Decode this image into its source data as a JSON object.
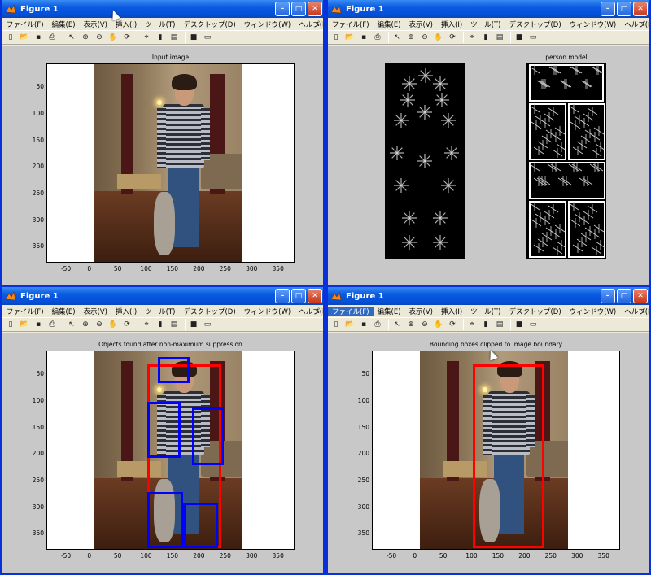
{
  "windows": [
    {
      "title": "Figure 1",
      "axes_title": "Input image",
      "active_menu": -1
    },
    {
      "title": "Figure 1",
      "axes_title": "",
      "model_title": "person model",
      "active_menu": -1
    },
    {
      "title": "Figure 1",
      "axes_title": "Objects found after non-maximum suppression",
      "active_menu": -1
    },
    {
      "title": "Figure 1",
      "axes_title": "Bounding boxes clipped to image boundary",
      "active_menu": 0
    }
  ],
  "menu": [
    "ファイル(F)",
    "編集(E)",
    "表示(V)",
    "挿入(I)",
    "ツール(T)",
    "デスクトップ(D)",
    "ウィンドウ(W)",
    "ヘルプ(H)"
  ],
  "toolbar_icons": [
    "new-file-icon",
    "open-folder-icon",
    "save-icon",
    "print-icon",
    "pointer-icon",
    "zoom-in-icon",
    "zoom-out-icon",
    "pan-hand-icon",
    "rotate-3d-icon",
    "data-cursor-icon",
    "colorbar-icon",
    "legend-icon",
    "hide-plot-tools-icon",
    "show-plot-tools-icon"
  ],
  "axes": {
    "x_ticks": [
      "-50",
      "0",
      "50",
      "100",
      "150",
      "200",
      "250",
      "300",
      "350"
    ],
    "y_ticks": [
      "50",
      "100",
      "150",
      "200",
      "250",
      "300",
      "350"
    ],
    "x_values": [
      -50,
      0,
      50,
      100,
      150,
      200,
      250,
      300,
      350
    ],
    "y_values": [
      50,
      100,
      150,
      200,
      250,
      300,
      350
    ],
    "xlim": [
      -90,
      380
    ],
    "ylim": [
      5,
      380
    ],
    "image_width": 280,
    "image_height": 380
  },
  "detections": {
    "color_person": "#ff0000",
    "color_parts": "#0000ff",
    "person_box": [
      100,
      30,
      240,
      375
    ],
    "person_box_clipped": [
      100,
      30,
      235,
      375
    ],
    "part_boxes": [
      [
        120,
        15,
        180,
        65
      ],
      [
        100,
        100,
        162,
        205
      ],
      [
        185,
        110,
        245,
        220
      ],
      [
        100,
        270,
        167,
        375
      ],
      [
        167,
        290,
        233,
        375
      ]
    ]
  },
  "colors": {
    "titlebar": "#0a5ae0",
    "figure_bg": "#c8c8c8",
    "window_border": "#0831d9"
  }
}
